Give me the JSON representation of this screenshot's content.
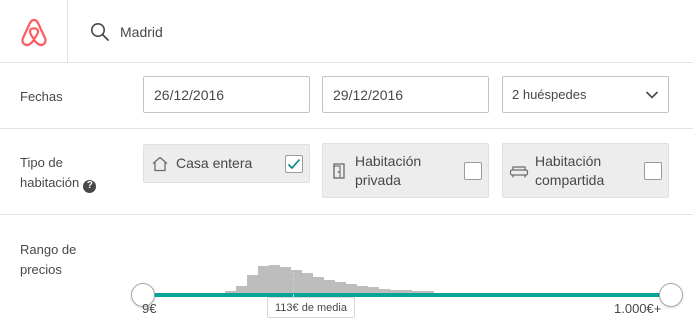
{
  "header": {
    "logo": "airbnb-logo",
    "search_icon": "search-icon",
    "search_value": "Madrid",
    "brand_color": "#FF5A5F"
  },
  "fechas": {
    "label": "Fechas",
    "check_in": "26/12/2016",
    "check_out": "29/12/2016",
    "guests": "2 huéspedes"
  },
  "tipo": {
    "label_line1": "Tipo de",
    "label_line2": "habitación",
    "help_icon": "?",
    "options": [
      {
        "icon": "house-icon",
        "label_line1": "Casa entera",
        "label_line2": "",
        "checked": true
      },
      {
        "icon": "door-icon",
        "label_line1": "Habitación",
        "label_line2": "privada",
        "checked": false
      },
      {
        "icon": "sofa-icon",
        "label_line1": "Habitación",
        "label_line2": "compartida",
        "checked": false
      }
    ]
  },
  "precio": {
    "label_line1": "Rango de",
    "label_line2": "precios",
    "min_label": "9€",
    "max_label": "1.000€+",
    "average_label": "113€ de media",
    "track_color": "#00A699",
    "histogram_relative_heights": [
      0.04,
      0.12,
      0.33,
      0.48,
      0.5,
      0.46,
      0.41,
      0.35,
      0.29,
      0.24,
      0.2,
      0.16,
      0.13,
      0.1,
      0.08,
      0.06,
      0.05,
      0.04,
      0.03
    ]
  }
}
